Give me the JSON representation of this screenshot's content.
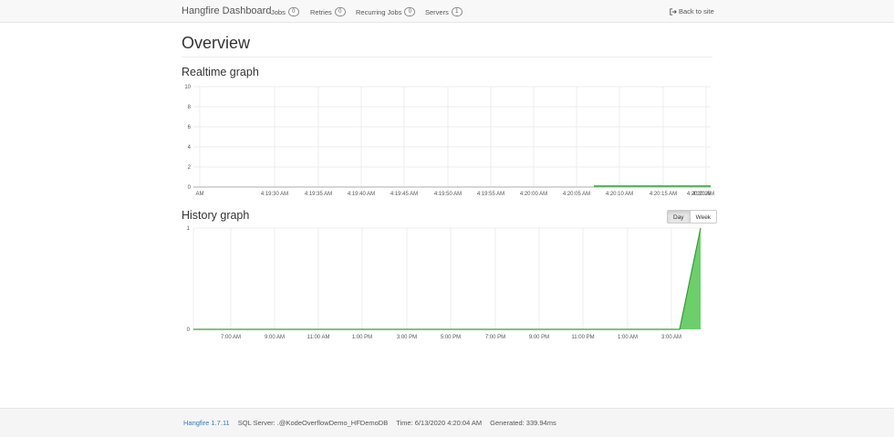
{
  "navbar": {
    "brand": "Hangfire Dashboard",
    "items": [
      {
        "label": "Jobs",
        "count": "0"
      },
      {
        "label": "Retries",
        "count": "0"
      },
      {
        "label": "Recurring Jobs",
        "count": "0"
      },
      {
        "label": "Servers",
        "count": "1"
      }
    ],
    "back_label": "Back to site"
  },
  "page": {
    "title": "Overview",
    "realtime_title": "Realtime graph",
    "history_title": "History graph",
    "range_buttons": [
      "Day",
      "Week"
    ],
    "active_range": "Day"
  },
  "colors": {
    "series_fill": "#6ccf6c",
    "series_line": "#3a9a3a",
    "grid": "#e8e8e8"
  },
  "chart_data": [
    {
      "type": "area",
      "ylim": [
        0,
        10
      ],
      "y_ticks": [
        "0",
        "2",
        "4",
        "6",
        "8",
        "10"
      ],
      "x_tick_labels": [
        "AM",
        "4:19:30 AM",
        "4:19:35 AM",
        "4:19:40 AM",
        "4:19:45 AM",
        "4:19:50 AM",
        "4:19:55 AM",
        "4:20:00 AM",
        "4:20:05 AM",
        "4:20:10 AM",
        "4:20:15 AM",
        "4:20:20 AM",
        "4:20:25"
      ],
      "series": [
        {
          "x": [
            "4:20:07 AM",
            "4:20:28 AM"
          ],
          "values": [
            0.1,
            0.1
          ]
        }
      ]
    },
    {
      "type": "area",
      "ylim": [
        0,
        1
      ],
      "y_ticks": [
        "0",
        "1"
      ],
      "x_tick_labels": [
        "7:00 AM",
        "9:00 AM",
        "11:00 AM",
        "1:00 PM",
        "3:00 PM",
        "5:00 PM",
        "7:00 PM",
        "9:00 PM",
        "11:00 PM",
        "1:00 AM",
        "3:00 AM"
      ],
      "series": [
        {
          "x": [
            "5:00 AM",
            "3:30 AM",
            "4:00 AM"
          ],
          "values": [
            0,
            0,
            1
          ]
        }
      ]
    }
  ],
  "footer": {
    "version": "Hangfire 1.7.11",
    "sql_server": "SQL Server: .@KodeOverflowDemo_HFDemoDB",
    "time": "Time: 6/13/2020 4:20:04 AM",
    "generated": "Generated: 339.94ms"
  }
}
